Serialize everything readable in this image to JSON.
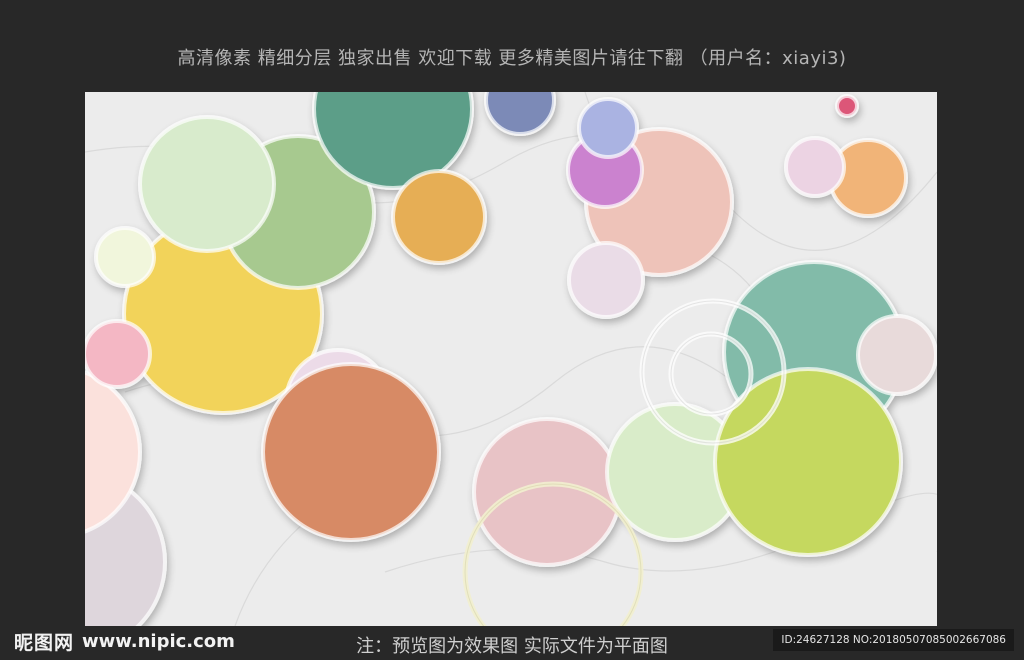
{
  "top_caption": "高清像素 精细分层 独家出售 欢迎下载 更多精美图片请往下翻 （用户名：xiayi3)",
  "footer": {
    "logo_text": "昵图网",
    "site_url": "www.nipic.com",
    "note": "注：预览图为效果图 实际文件为平面图",
    "id_text": "ID:24627128 NO:20180507085002667086"
  },
  "colors": {
    "background": "#282828",
    "marble": "#ececec",
    "yellow": "#f2d35a",
    "green": "#a7c98f",
    "mint": "#d6eac9",
    "teal": "#5a9e88",
    "orange": "#e5ae55",
    "terracotta": "#d78a65",
    "pink": "#f3b6c4",
    "salmon": "#edc0b7",
    "lime": "#c5d85e",
    "lavender": "#a9b2e2",
    "purple": "#cb82cf"
  }
}
